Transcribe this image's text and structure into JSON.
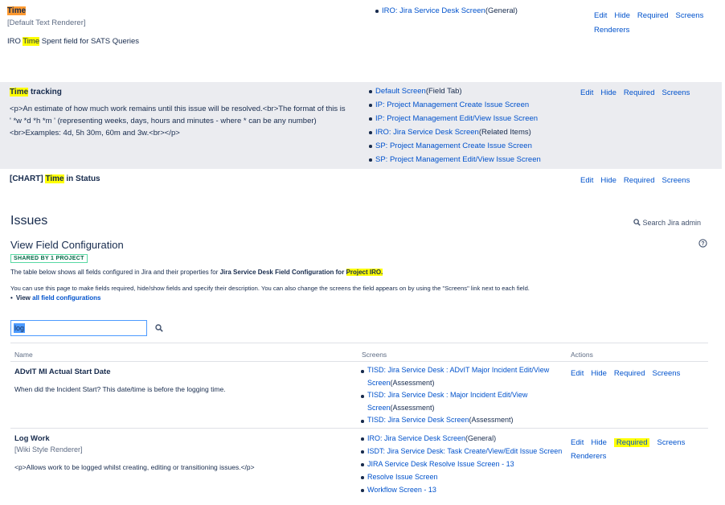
{
  "top_rows": [
    {
      "name_hl": "Time",
      "renderer": "[Default Text Renderer]",
      "desc_pre": "IRO ",
      "desc_hl": "Time",
      "desc_post": " Spent field for SATS Queries",
      "screens": [
        {
          "link": "IRO: Jira Service Desk Screen",
          "suffix": "(General)"
        }
      ],
      "actions": [
        "Edit",
        "Hide",
        "Required",
        "Screens",
        "Renderers"
      ]
    },
    {
      "name_hl": "Time",
      "name_rest": " tracking",
      "desc_lines": [
        "<p>An estimate of how much work remains until this issue will be resolved.<br>The format of this is",
        "' *w *d *h *m ' (representing weeks, days, hours and minutes - where * can be any number)",
        "<br>Examples: 4d, 5h 30m, 60m and 3w.<br></p>"
      ],
      "screens": [
        {
          "link": "Default Screen",
          "suffix": "(Field Tab)"
        },
        {
          "link": "IP: Project Management Create Issue Screen",
          "suffix": ""
        },
        {
          "link": "IP: Project Management Edit/View Issue Screen",
          "suffix": ""
        },
        {
          "link": "IRO: Jira Service Desk Screen",
          "suffix": "(Related Items)"
        },
        {
          "link": "SP: Project Management Create Issue Screen",
          "suffix": ""
        },
        {
          "link": "SP: Project Management Edit/View Issue Screen",
          "suffix": ""
        }
      ],
      "actions": [
        "Edit",
        "Hide",
        "Required",
        "Screens"
      ]
    },
    {
      "name_pre": "[CHART] ",
      "name_hl": "Time",
      "name_rest": " in Status",
      "actions": [
        "Edit",
        "Hide",
        "Required",
        "Screens"
      ]
    }
  ],
  "page": {
    "title": "Issues",
    "search_admin": "Search Jira admin",
    "subtitle": "View Field Configuration",
    "shared_badge": "SHARED BY 1 PROJECT",
    "desc1_pre": "The table below shows all fields configured in Jira and their properties for ",
    "desc1_bold": "Jira Service Desk Field Configuration for ",
    "desc1_hl": "Project IRO.",
    "desc2": "You can use this page to make fields required, hide/show fields and specify their description. You can also change the screens the field appears on by using the \"Screens\" link next to each field.",
    "view_pre": "View ",
    "view_link": "all field configurations",
    "filter_value": "log",
    "col_name": "Name",
    "col_screens": "Screens",
    "col_actions": "Actions"
  },
  "rows": [
    {
      "name": "ADvIT MI Actual Start Date",
      "desc": "When did the Incident Start? This date/time is before the logging time.",
      "screens_lines": [
        [
          {
            "t": "link",
            "v": "TISD: Jira Service Desk : ADvIT Major Incident Edit/View"
          }
        ],
        [
          {
            "t": "link",
            "v": "Screen"
          },
          {
            "t": "text",
            "v": "(Assessment)"
          }
        ],
        [
          {
            "t": "link",
            "v": "TISD: Jira Service Desk : Major Incident Edit/View"
          }
        ],
        [
          {
            "t": "link",
            "v": "Screen"
          },
          {
            "t": "text",
            "v": "(Assessment)"
          }
        ],
        [
          {
            "t": "link",
            "v": "TISD: Jira Service Desk Screen"
          },
          {
            "t": "text",
            "v": "(Assessment)"
          }
        ]
      ],
      "actions": [
        "Edit",
        "Hide",
        "Required",
        "Screens"
      ]
    },
    {
      "name": "Log Work",
      "renderer": "[Wiki Style Renderer]",
      "desc": "<p>Allows work to be logged whilst creating, editing or transitioning issues.</p>",
      "screens": [
        {
          "link": "IRO: Jira Service Desk Screen",
          "suffix": "(General)"
        },
        {
          "link": "ISDT: Jira Service Desk: Task Create/View/Edit Issue Screen",
          "suffix": ""
        },
        {
          "link": "JIRA Service Desk Resolve Issue Screen - 13",
          "suffix": ""
        },
        {
          "link": "Resolve Issue Screen",
          "suffix": ""
        },
        {
          "link": "Workflow Screen - 13",
          "suffix": ""
        }
      ],
      "actions": [
        "Edit",
        "Hide",
        "Required",
        "Screens",
        "Renderers"
      ]
    }
  ]
}
